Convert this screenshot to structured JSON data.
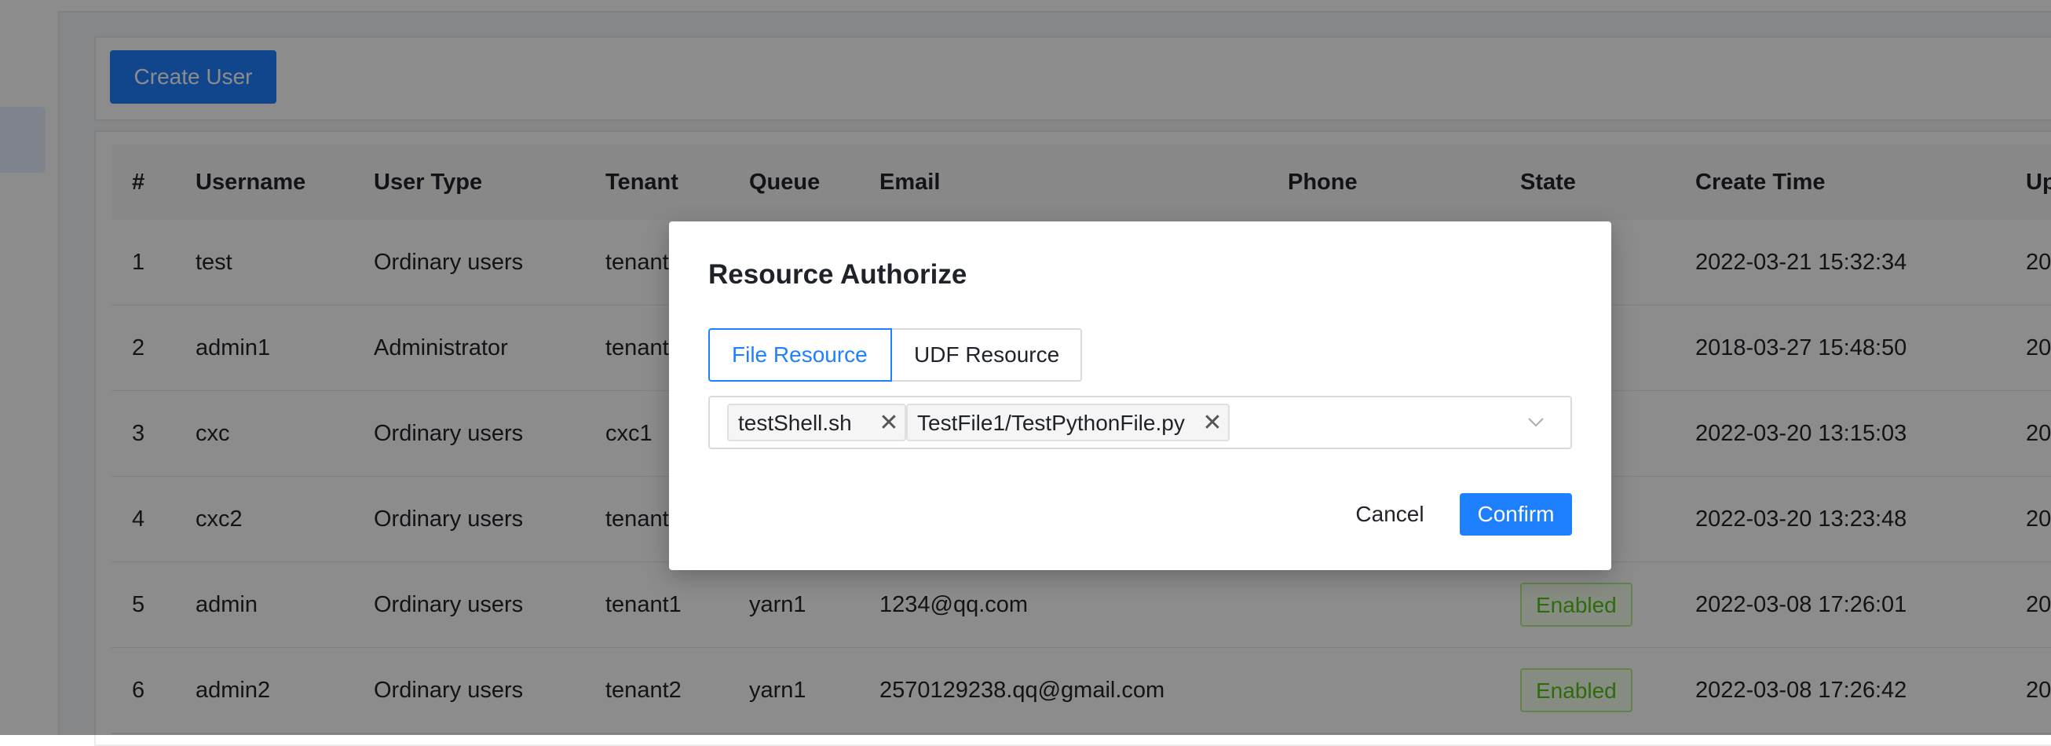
{
  "toolbar": {
    "create_user_label": "Create User"
  },
  "table": {
    "columns": [
      "#",
      "Username",
      "User Type",
      "Tenant",
      "Queue",
      "Email",
      "Phone",
      "State",
      "Create Time",
      "Up"
    ],
    "rows": [
      {
        "index": "1",
        "username": "test",
        "user_type": "Ordinary users",
        "tenant": "tenant",
        "queue": "",
        "email": "",
        "phone": "",
        "state": "",
        "create_time": "2022-03-21 15:32:34",
        "update": "20"
      },
      {
        "index": "2",
        "username": "admin1",
        "user_type": "Administrator",
        "tenant": "tenant",
        "queue": "",
        "email": "",
        "phone": "",
        "state": "",
        "create_time": "2018-03-27 15:48:50",
        "update": "20"
      },
      {
        "index": "3",
        "username": "cxc",
        "user_type": "Ordinary users",
        "tenant": "cxc1",
        "queue": "",
        "email": "",
        "phone": "",
        "state": "",
        "create_time": "2022-03-20 13:15:03",
        "update": "20"
      },
      {
        "index": "4",
        "username": "cxc2",
        "user_type": "Ordinary users",
        "tenant": "tenant",
        "queue": "",
        "email": "",
        "phone": "",
        "state": "",
        "create_time": "2022-03-20 13:23:48",
        "update": "20"
      },
      {
        "index": "5",
        "username": "admin",
        "user_type": "Ordinary users",
        "tenant": "tenant1",
        "queue": "yarn1",
        "email": "1234@qq.com",
        "phone": "",
        "state": "Enabled",
        "create_time": "2022-03-08 17:26:01",
        "update": "20"
      },
      {
        "index": "6",
        "username": "admin2",
        "user_type": "Ordinary users",
        "tenant": "tenant2",
        "queue": "yarn1",
        "email": "2570129238.qq@gmail.com",
        "phone": "",
        "state": "Enabled",
        "create_time": "2022-03-08 17:26:42",
        "update": "20"
      }
    ]
  },
  "dialog": {
    "title": "Resource Authorize",
    "tabs": [
      "File Resource",
      "UDF Resource"
    ],
    "active_tab": "File Resource",
    "selected": [
      "testShell.sh",
      "TestFile1/TestPythonFile.py"
    ],
    "cancel_label": "Cancel",
    "confirm_label": "Confirm"
  },
  "colors": {
    "primary": "#1f80ff",
    "enabled_text": "#52c41a",
    "enabled_border": "#b7eb8f"
  },
  "icons": {
    "tag_close": "close-icon",
    "select_arrow": "chevron-down-icon"
  }
}
